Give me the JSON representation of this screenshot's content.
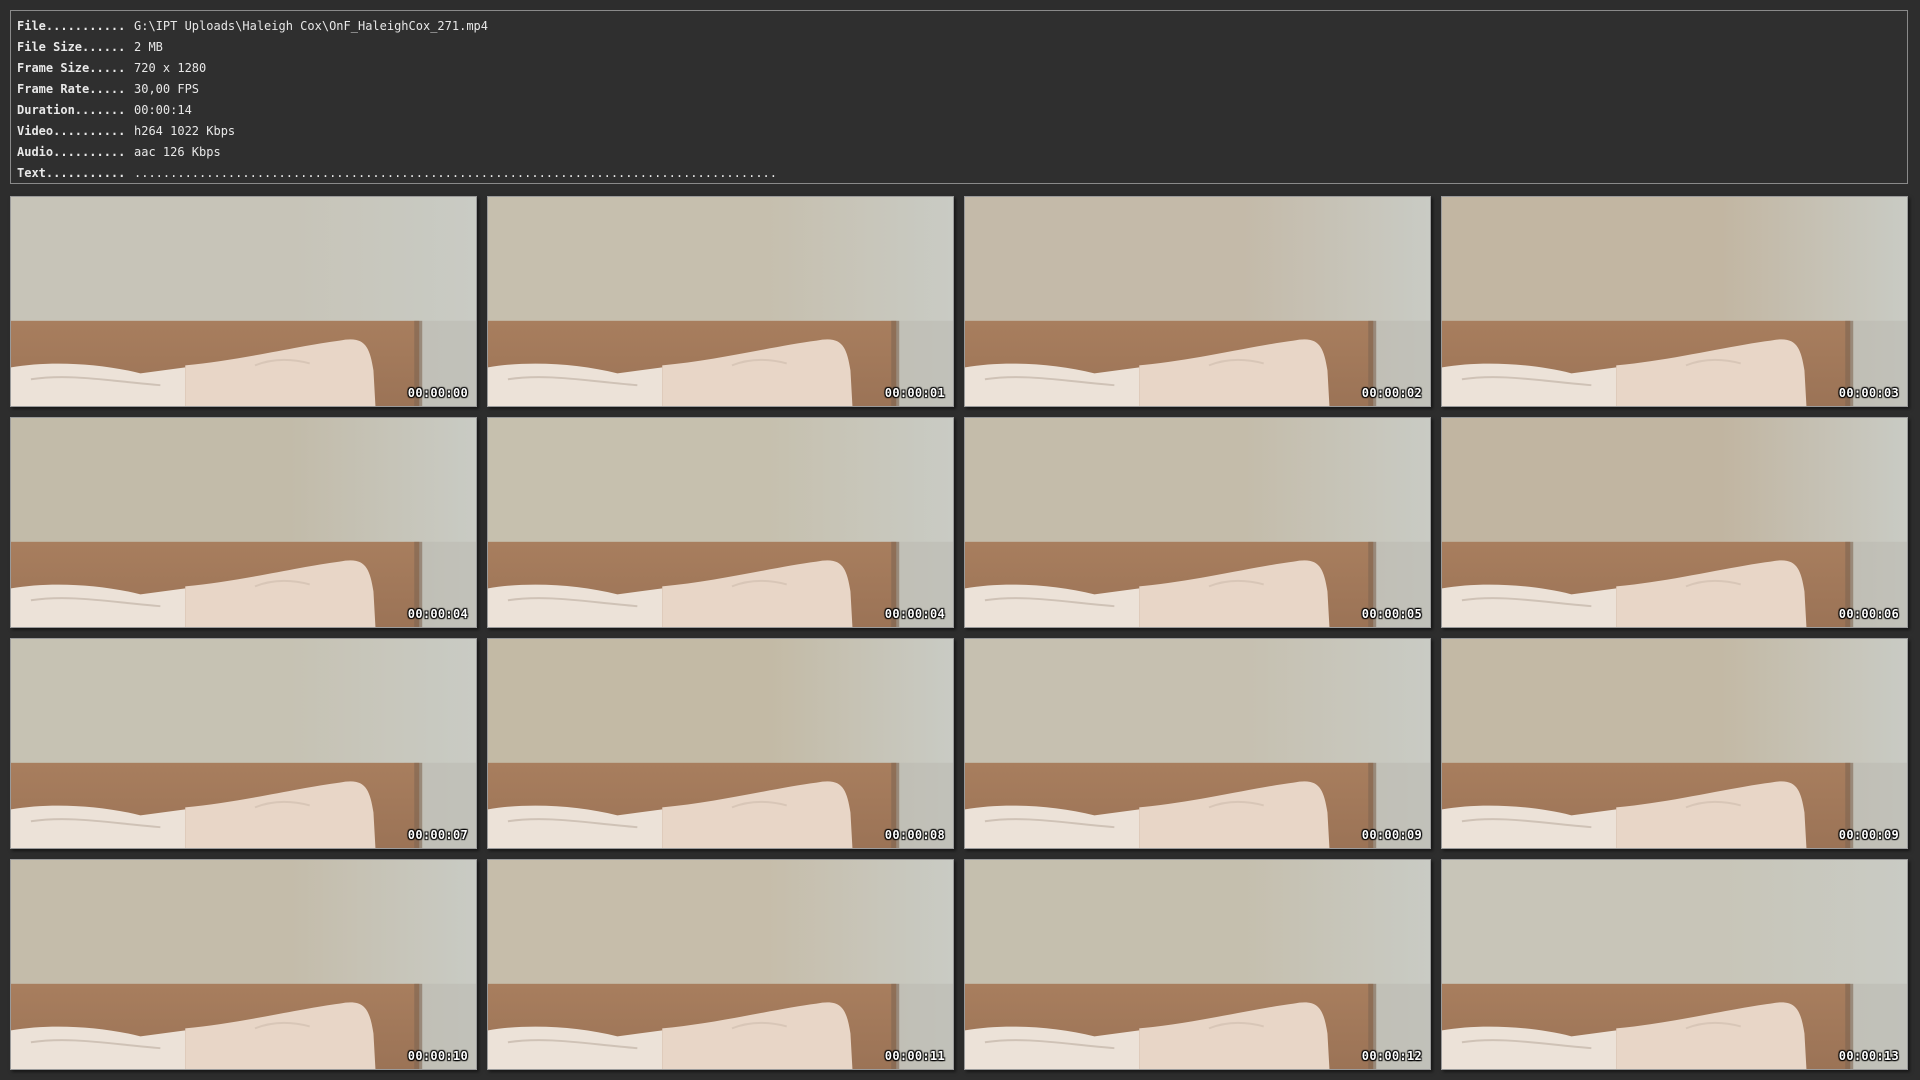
{
  "info": {
    "file_label": "File...........",
    "file_value": "G:\\IPT Uploads\\Haleigh Cox\\OnF_HaleighCox_271.mp4",
    "size_label": "File Size......",
    "size_value": "2 MB",
    "frame_label": "Frame Size.....",
    "frame_value": "720 x 1280",
    "rate_label": "Frame Rate.....",
    "rate_value": "30,00 FPS",
    "duration_label": "Duration.......",
    "duration_value": "00:00:14",
    "video_label": "Video..........",
    "video_value": "h264 1022 Kbps",
    "audio_label": "Audio..........",
    "audio_value": "aac 126 Kbps",
    "text_label": "Text...........",
    "text_value": "........................................................................................."
  },
  "thumbnails": [
    {
      "time": "00:00:00",
      "wall": "#c7c4b8"
    },
    {
      "time": "00:00:01",
      "wall": "#c6bfae"
    },
    {
      "time": "00:00:02",
      "wall": "#c4baa9"
    },
    {
      "time": "00:00:03",
      "wall": "#c2b6a2"
    },
    {
      "time": "00:00:04",
      "wall": "#c2bba9"
    },
    {
      "time": "00:00:04",
      "wall": "#c6c0ae"
    },
    {
      "time": "00:00:05",
      "wall": "#c4bcaa"
    },
    {
      "time": "00:00:06",
      "wall": "#c1b5a1"
    },
    {
      "time": "00:00:07",
      "wall": "#c6c2b3"
    },
    {
      "time": "00:00:08",
      "wall": "#c3baa5"
    },
    {
      "time": "00:00:09",
      "wall": "#c6c0b0"
    },
    {
      "time": "00:00:09",
      "wall": "#c3b9a5"
    },
    {
      "time": "00:00:10",
      "wall": "#c4bcaa"
    },
    {
      "time": "00:00:11",
      "wall": "#c6bdaa"
    },
    {
      "time": "00:00:12",
      "wall": "#c5bfae"
    },
    {
      "time": "00:00:13",
      "wall": "#c8c5b8"
    }
  ],
  "colors": {
    "background": "#2d2d2d",
    "headboard": "#9b7356",
    "headboard_top": "#a87e5e",
    "pillow": "#e8d6c7",
    "sheet": "#ece2d8",
    "timestamp": "#ffffff"
  }
}
